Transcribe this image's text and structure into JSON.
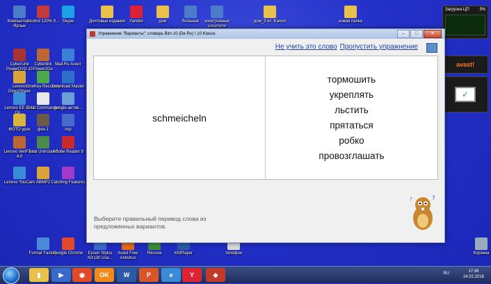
{
  "desktop": {
    "icons": [
      {
        "label": "Компьютер - Ярлык",
        "color": "#4a7cc9"
      },
      {
        "label": "Alcohol 120% X...",
        "color": "#c53a3a"
      },
      {
        "label": "Skype",
        "color": "#1ea0e6"
      },
      {
        "label": "CyberLink PowerDVD 10",
        "color": "#a33"
      },
      {
        "label": "Cyberlink Power2Go",
        "color": "#b63"
      },
      {
        "label": "Mail.Ru Агент",
        "color": "#3b7fd8"
      },
      {
        "label": "Lenovo DirectShare",
        "color": "#d9a43a"
      },
      {
        "label": "OneKey Recovery",
        "color": "#4aa84a"
      },
      {
        "label": "Download Master",
        "color": "#2b6fc9"
      },
      {
        "label": "Lenovo EE Boot Op...",
        "color": "#3a8bd8"
      },
      {
        "label": "Total Commander",
        "color": "#e8e8e8"
      },
      {
        "label": "google-актив...",
        "color": "#6a9fd8"
      },
      {
        "label": "ФОТО урок",
        "color": "#d8b43a"
      },
      {
        "label": "фон.1",
        "color": "#6a5a4a"
      },
      {
        "label": "nkp",
        "color": "#4a6ac9"
      },
      {
        "label": "Lenovo VeriFace 4.0",
        "color": "#b63"
      },
      {
        "label": "Total Uninstall 5",
        "color": "#4a8a4a"
      },
      {
        "label": "Adobe Reader 9",
        "color": "#c82a2a"
      },
      {
        "label": "Lenovo YouCam",
        "color": "#3a8bd8"
      },
      {
        "label": "ABMP2",
        "color": "#d9a43a"
      },
      {
        "label": "Catching Features",
        "color": "#a03ac9"
      },
      {
        "label": "Format Factory",
        "color": "#4a8ad8"
      },
      {
        "label": "Google Chrome",
        "color": "#e04a2a"
      },
      {
        "label": "Epson Stylus NX130 Use...",
        "color": "#3a6ac9"
      },
      {
        "label": "Avast Free Antivirus",
        "color": "#e06a1a"
      },
      {
        "label": "Recuva",
        "color": "#3a8a3a"
      },
      {
        "label": "KMPlayer",
        "color": "#2a5aa8"
      },
      {
        "label": "телефон",
        "color": "#d8d8d8"
      },
      {
        "label": "Корзина",
        "color": "#9ab"
      }
    ],
    "top_folders": [
      {
        "label": "Дочтовые издания",
        "color": "#e8c04a"
      },
      {
        "label": "Yandex",
        "color": "#d23"
      },
      {
        "label": "дом",
        "color": "#e8c04a"
      },
      {
        "label": "больные",
        "color": "#4a7cc9"
      },
      {
        "label": "электронные носители",
        "color": "#4a7cc9"
      },
      {
        "label": "дом_3 кл. Kanon",
        "color": "#e8c04a"
      },
      {
        "label": "новая папка",
        "color": "#e8c04a"
      }
    ]
  },
  "gadgets": {
    "cpu_title": "Загрузка ЦП",
    "cpu_percent": "3%",
    "avast_label": "avast!"
  },
  "window": {
    "title": "Упражнение \"Варианты\": словарь Bim 10 (De-Ru) \\ 10 Klasse",
    "links": {
      "skip_word": "Не учить это слово",
      "skip_exercise": "Пропустить упражнение"
    },
    "word": "schmeicheln",
    "choices": [
      "тормошить",
      "укреплять",
      "льстить",
      "прятаться",
      "робко",
      "провозглашать"
    ],
    "hint": "Выберите правильный перевод слова из предложенных вариантов."
  },
  "taskbar": {
    "lang": "RU",
    "time": "17:36",
    "date": "24.02.2016",
    "buttons": [
      {
        "name": "explorer",
        "color": "#e8c04a",
        "glyph": "▮"
      },
      {
        "name": "media",
        "color": "#3a6ac9",
        "glyph": "▶"
      },
      {
        "name": "chrome",
        "color": "#e04a2a",
        "glyph": "◉"
      },
      {
        "name": "ok",
        "color": "#f08a1a",
        "glyph": "OK"
      },
      {
        "name": "word",
        "color": "#2a5aa8",
        "glyph": "W"
      },
      {
        "name": "powerpoint",
        "color": "#d8542a",
        "glyph": "P"
      },
      {
        "name": "ie",
        "color": "#3a8ad8",
        "glyph": "e"
      },
      {
        "name": "yandex",
        "color": "#d23",
        "glyph": "Y"
      },
      {
        "name": "app",
        "color": "#c0392b",
        "glyph": "◆"
      }
    ]
  }
}
